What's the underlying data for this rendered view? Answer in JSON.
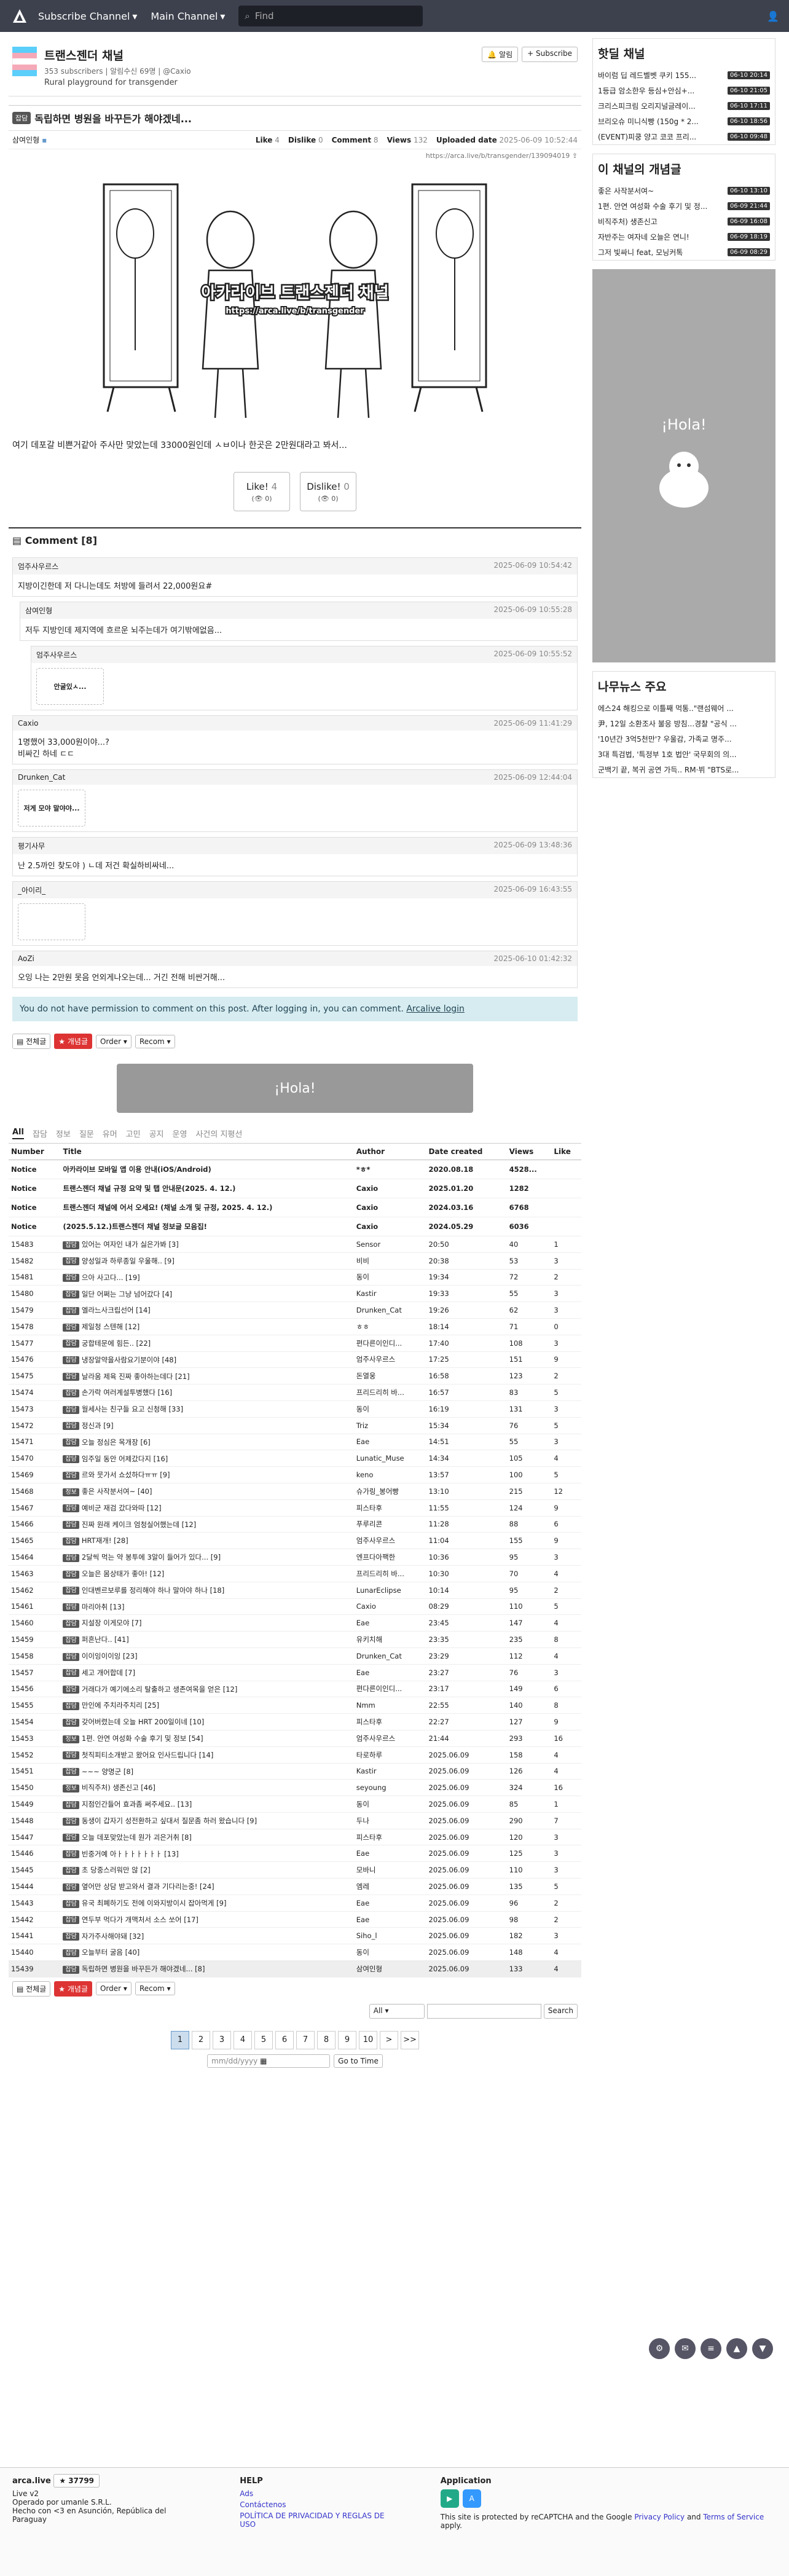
{
  "topnav": {
    "subscribe": "Subscribe Channel",
    "main": "Main Channel",
    "search_placeholder": "Find"
  },
  "channel": {
    "title": "트랜스젠더 채널",
    "subscribers": "353 subscribers",
    "notify_count": "알림수신 69명",
    "handle": "@Caxio",
    "desc": "Rural playground for transgender",
    "btn_alarm": "알림",
    "btn_subscribe": "Subscribe"
  },
  "post": {
    "category": "잡담",
    "title": "독립하면 병원을 바꾸든가 해야겠네...",
    "author": "삼여인형",
    "like_label": "Like",
    "like": "4",
    "dislike_label": "Dislike",
    "dislike": "0",
    "comment_label": "Comment",
    "comment": "8",
    "views_label": "Views",
    "views": "132",
    "uploaded_label": "Uploaded date",
    "uploaded": "2025-06-09 10:52:44",
    "url": "https://arca.live/b/transgender/139094019",
    "watermark1": "아카라이브 트랜스젠더 채널",
    "watermark2": "https://arca.live/b/transgender",
    "text": "여기 데포갈 비쁜거같아 주사만 맞았는데 33000원인데 ㅅㅂ이나 한곳은 2만원대라고 봐서...",
    "like_btn": "Like!",
    "like_val": "4",
    "like_sub": "0",
    "dislike_btn": "Dislike!",
    "dislike_val": "0",
    "dislike_sub": "0"
  },
  "comments_head": "Comment [8]",
  "comments": [
    {
      "author": "엄주사우르스",
      "time": "2025-06-09 10:54:42",
      "text": "지방이긴한데 저 다니는데도 처방에 들려서 22,000원요#",
      "level": 0
    },
    {
      "author": "삼여인형",
      "time": "2025-06-09 10:55:28",
      "text": "저두 지방인데 제지역에 흐르운 뇌주는데가 여기밖에없음...",
      "level": 1
    },
    {
      "author": "엄주사우르스",
      "time": "2025-06-09 10:55:52",
      "text": "",
      "level": 2,
      "sticker": "안굴있ㅅ..."
    },
    {
      "author": "Caxio",
      "time": "2025-06-09 11:41:29",
      "text": "1명했어 33,000원이야...?\n비싸긴 하네 ㄷㄷ",
      "level": 0
    },
    {
      "author": "Drunken_Cat",
      "time": "2025-06-09 12:44:04",
      "text": "",
      "level": 0,
      "sticker": "저게 모야 말야야..."
    },
    {
      "author": "평기사무",
      "time": "2025-06-09 13:48:36",
      "text": "난 2.5까인 찾도야 ) ㄴ데 저건 확실하비싸네...",
      "level": 0
    },
    {
      "author": "_아이리_",
      "time": "2025-06-09 16:43:55",
      "text": "",
      "level": 0,
      "sticker": ""
    },
    {
      "author": "AoZi",
      "time": "2025-06-10 01:42:32",
      "text": "오잉 나는 2만원 못음 언외게나오는데... 거긴 전해 비싼거해...",
      "level": 0
    }
  ],
  "noperm": {
    "text": "You do not have permission to comment on this post. After logging in, you can comment.",
    "link": "Arcalive login"
  },
  "tools": {
    "all": "전체글",
    "best": "개념글",
    "order": "Order",
    "recom": "Recom"
  },
  "ad_text": "¡Hola!",
  "tabs": [
    "All",
    "잡담",
    "정보",
    "질문",
    "유머",
    "고민",
    "공지",
    "운영",
    "사건의 지평선"
  ],
  "table": {
    "headers": [
      "Number",
      "Title",
      "Author",
      "Date created",
      "Views",
      "Like"
    ],
    "notices": [
      {
        "n": "Notice",
        "t": "아카라이브 모바일 앱 이용 안내(iOS/Android)",
        "a": "*ㅎ*",
        "d": "2020.08.18",
        "v": "4528...",
        "l": ""
      },
      {
        "n": "Notice",
        "t": "트랜스젠더 채널 규정 요약 및 탭 안내문(2025. 4. 12.)",
        "a": "Caxio",
        "d": "2025.01.20",
        "v": "1282",
        "l": ""
      },
      {
        "n": "Notice",
        "t": "트랜스젠더 채널에 어서 오세요! (채널 소개 및 규정, 2025. 4. 12.)",
        "a": "Caxio",
        "d": "2024.03.16",
        "v": "6768",
        "l": ""
      },
      {
        "n": "Notice",
        "t": "(2025.5.12.)트랜스젠더 채널 정보글 모음집!",
        "a": "Caxio",
        "d": "2024.05.29",
        "v": "6036",
        "l": ""
      }
    ],
    "rows": [
      [
        "15483",
        "잡담",
        "있어는 여자인 내가 싫은가봐 [3]",
        "Sensor",
        "20:50",
        "40",
        "1"
      ],
      [
        "15482",
        "잡담",
        "양성일과 하루종일 우울해.. [9]",
        "비비",
        "20:38",
        "53",
        "3"
      ],
      [
        "15481",
        "잡담",
        "으아 사고다... [19]",
        "동이",
        "19:34",
        "72",
        "2"
      ],
      [
        "15480",
        "잡담",
        "일단 어쩌는 그냥 넘어갔다 [4]",
        "Kastir",
        "19:33",
        "55",
        "3"
      ],
      [
        "15479",
        "잡담",
        "엘라느사크립선어 [14]",
        "Drunken_Cat",
        "19:26",
        "62",
        "3"
      ],
      [
        "15478",
        "잡담",
        "제일청 스텐해 [12]",
        "ㅎㅎ",
        "18:14",
        "71",
        "0"
      ],
      [
        "15477",
        "잡담",
        "궁합테문에 힘든.. [22]",
        "편다른이인디...",
        "17:40",
        "108",
        "3"
      ],
      [
        "15476",
        "잡담",
        "냉장알약을사람요기분이야 [48]",
        "엄주사우르스",
        "17:25",
        "151",
        "9"
      ],
      [
        "15475",
        "잡담",
        "날라움 제육 진짜 좋아하는데다 [21]",
        "돈열웅",
        "16:58",
        "123",
        "2"
      ],
      [
        "15474",
        "잡담",
        "손가락 여러계설투병했다 [16]",
        "프리드리히 바...",
        "16:57",
        "83",
        "5"
      ],
      [
        "15473",
        "잡담",
        "월세사는 친구들 요고 신청해 [33]",
        "동이",
        "16:19",
        "131",
        "3"
      ],
      [
        "15472",
        "잡담",
        "정신과 [9]",
        "Triz",
        "15:34",
        "76",
        "5"
      ],
      [
        "15471",
        "잡담",
        "오늘 정심은 목개장 [6]",
        "Eae",
        "14:51",
        "55",
        "3"
      ],
      [
        "15470",
        "잡담",
        "임주일 동안 어제갔다지 [16]",
        "Lunatic_Muse",
        "14:34",
        "105",
        "4"
      ],
      [
        "15469",
        "잡담",
        "르와 뭇가서 쇼섰하다ㅠㅠ [9]",
        "keno",
        "13:57",
        "100",
        "5"
      ],
      [
        "15468",
        "정보",
        "좋은 사작분서여~ [40]",
        "슈가링_봉어빵",
        "13:10",
        "215",
        "12"
      ],
      [
        "15467",
        "잡담",
        "예비군 재검 갔다와따 [12]",
        "피스타후",
        "11:55",
        "124",
        "9"
      ],
      [
        "15466",
        "잡담",
        "진짜 원래 케이크 엄청실어했는데 [12]",
        "푸루리콘",
        "11:28",
        "88",
        "6"
      ],
      [
        "15465",
        "잡담",
        "HRT재개! [28]",
        "엄주사우르스",
        "11:04",
        "155",
        "9"
      ],
      [
        "15464",
        "잡담",
        "2달씩 먹는 약 봉투에 3알이 들어가 있다... [9]",
        "엔프다아팩한",
        "10:36",
        "95",
        "3"
      ],
      [
        "15463",
        "잡담",
        "오늘은 몸상태가 좋아! [12]",
        "프리드리히 바...",
        "10:30",
        "70",
        "4"
      ],
      [
        "15462",
        "잡담",
        "인대벤르보루를 정리해야 하나 말아야 하나 [18]",
        "LunarEclipse",
        "10:14",
        "95",
        "2"
      ],
      [
        "15461",
        "잡담",
        "마리아취 [13]",
        "Caxio",
        "08:29",
        "110",
        "5"
      ],
      [
        "15460",
        "잡담",
        "지설장 이게모야 [7]",
        "Eae",
        "23:45",
        "147",
        "4"
      ],
      [
        "15459",
        "잡담",
        "퍼흔난다.. [41]",
        "유키치해",
        "23:35",
        "235",
        "8"
      ],
      [
        "15458",
        "잡담",
        "이이잉이이잉 [23]",
        "Drunken_Cat",
        "23:29",
        "112",
        "4"
      ],
      [
        "15457",
        "잡담",
        "세고 개어합데 [7]",
        "Eae",
        "23:27",
        "76",
        "3"
      ],
      [
        "15456",
        "잡담",
        "거래다가 예기에소리 탈출하고 생존여목을 얻은 [12]",
        "편다른이인디...",
        "23:17",
        "149",
        "6"
      ],
      [
        "15455",
        "잡담",
        "만인에 주치라주치리 [25]",
        "Nmm",
        "22:55",
        "140",
        "8"
      ],
      [
        "15454",
        "잡담",
        "갖어버렸는데 오늘 HRT 200일이네 [10]",
        "피스타후",
        "22:27",
        "127",
        "9"
      ],
      [
        "15453",
        "정보",
        "1편. 안연 여성화 수술 후기 및 정보 [54]",
        "엄주사우르스",
        "21:44",
        "293",
        "16"
      ],
      [
        "15452",
        "잡담",
        "첫직피티소개받고 왔어요 인사드립니다 [14]",
        "타로하루",
        "2025.06.09",
        "158",
        "4"
      ],
      [
        "15451",
        "잡담",
        "~~~ 양명군 [8]",
        "Kastir",
        "2025.06.09",
        "126",
        "4"
      ],
      [
        "15450",
        "정보",
        "비직주처) 생존신고 [46]",
        "seyoung",
        "2025.06.09",
        "324",
        "16"
      ],
      [
        "15449",
        "잡담",
        "지점인간들어 효과좀 써주세요.. [13]",
        "동이",
        "2025.06.09",
        "85",
        "1"
      ],
      [
        "15448",
        "잡담",
        "동생이 갑자기 성전환하고 싶대서 질문좀 하러 왔습니다 [9]",
        "두나",
        "2025.06.09",
        "290",
        "7"
      ],
      [
        "15447",
        "잡담",
        "오늘 데포맞았는데 원가 괴은거취 [8]",
        "피스타후",
        "2025.06.09",
        "120",
        "3"
      ],
      [
        "15446",
        "잡담",
        "빈중거예 아ㅏㅏㅏㅏㅏㅏㅏ [13]",
        "Eae",
        "2025.06.09",
        "125",
        "3"
      ],
      [
        "15445",
        "잡담",
        "초 당중스러워만 않 [2]",
        "모바니",
        "2025.06.09",
        "110",
        "3"
      ],
      [
        "15444",
        "잡담",
        "옆어만 상담 받고와서 결과 기다리는중! [24]",
        "엠레",
        "2025.06.09",
        "135",
        "5"
      ],
      [
        "15443",
        "잡담",
        "유국 최폐하기도 전에 이와지방이시 잡아먹게 [9]",
        "Eae",
        "2025.06.09",
        "96",
        "2"
      ],
      [
        "15442",
        "잡담",
        "연두부 먹다가 개맥처서 소스 쏘어 [17]",
        "Eae",
        "2025.06.09",
        "98",
        "2"
      ],
      [
        "15441",
        "잡담",
        "자가주사해야돼 [32]",
        "Siho_l",
        "2025.06.09",
        "182",
        "3"
      ],
      [
        "15440",
        "잡담",
        "오늘부터 굴음 [40]",
        "동이",
        "2025.06.09",
        "148",
        "4"
      ],
      [
        "15439",
        "잡담",
        "독립하면 병원을 바꾸든가 해야겠네... [8]",
        "삼여인형",
        "2025.06.09",
        "133",
        "4"
      ]
    ]
  },
  "search": {
    "scope": "All",
    "button": "Search"
  },
  "pager": [
    "1",
    "2",
    "3",
    "4",
    "5",
    "6",
    "7",
    "8",
    "9",
    "10",
    ">",
    ">>"
  ],
  "datejump": {
    "placeholder": "mm/dd/yyyy",
    "button": "Go to Time"
  },
  "sidebar": {
    "hot_title": "핫딜 채널",
    "hot": [
      {
        "t": "바이럼 딥 레드벨벳 쿠키 155...",
        "tm": "06-10 20:14"
      },
      {
        "t": "1등급 암소한우 등심+안심+...",
        "tm": "06-10 21:05"
      },
      {
        "t": "크리스피크림 오리지널글레이...",
        "tm": "06-10 17:11"
      },
      {
        "t": "브리오슈 미니식빵 (150g * 2...",
        "tm": "06-10 18:56"
      },
      {
        "t": "(EVENT)피쿵 양고 코코 프리...",
        "tm": "06-10 09:48"
      }
    ],
    "best_title": "이 채널의 개념글",
    "best": [
      {
        "t": "좋은 사작분서여~",
        "tm": "06-10 13:10"
      },
      {
        "t": "1편. 안연 여성화 수술 후기 및 정...",
        "tm": "06-09 21:44"
      },
      {
        "t": "비직주처) 생존신고",
        "tm": "06-09 16:08"
      },
      {
        "t": "자반주는 여자네 오늘은 연니!",
        "tm": "06-09 18:19"
      },
      {
        "t": "그저 빛싸니 feat, 모닝커톡",
        "tm": "06-09 08:29"
      }
    ],
    "news_title": "나무뉴스 주요",
    "news": [
      "에스24 해킹으로 이틀째 먹통..\"랜섬웨어 ...",
      "尹, 12일 소환조사 불응 방침...경찰 \"공식 ...",
      "'10년간 3억5천만'? 우울감, 가족교 명주...",
      "3대 특검법, '특정부 1호 법안' 국무회의 의...",
      "군백기 끝, 복귀 공연 가득.. RM·뷔 \"BTS로..."
    ],
    "ad_text": "¡Hola!"
  },
  "footer": {
    "brand": "arca.live",
    "stars": "37799",
    "version": "Live v2",
    "company": "Operado por umanle S.R.L.",
    "made": "Hecho con <3 en Asunción, República del Paraguay",
    "help": "HELP",
    "ads": "Ads",
    "contact": "Contáctenos",
    "policy": "POLÍTICA DE PRIVACIDAD Y REGLAS DE USO",
    "app": "Application",
    "recaptcha": "This site is protected by reCAPTCHA and the Google",
    "privacy": "Privacy Policy",
    "and": "and",
    "terms": "Terms of Service",
    "apply": "apply."
  }
}
